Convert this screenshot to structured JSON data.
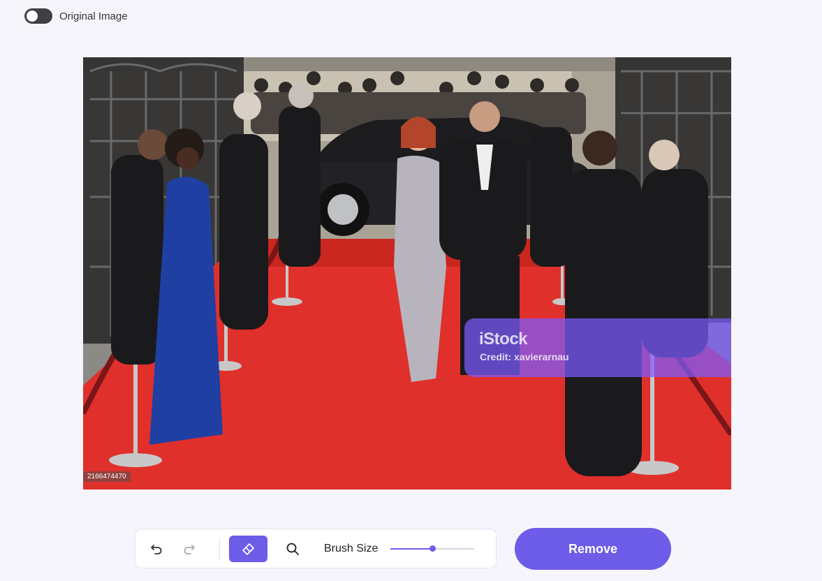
{
  "header": {
    "toggle_label": "Original Image",
    "toggle_on": false
  },
  "canvas": {
    "watermark_brand": "iStock",
    "watermark_credit": "Credit: xavierarnau",
    "image_id": "2166474470"
  },
  "toolbar": {
    "undo_icon": "undo-icon",
    "redo_icon": "redo-icon",
    "eraser_icon": "eraser-icon",
    "zoom_icon": "search-icon",
    "brush_label": "Brush Size",
    "brush_size_fraction": 0.5
  },
  "actions": {
    "remove_label": "Remove"
  },
  "colors": {
    "accent": "#6c5ce7",
    "background": "#f6f5fc",
    "carpet": "#e0302c"
  }
}
